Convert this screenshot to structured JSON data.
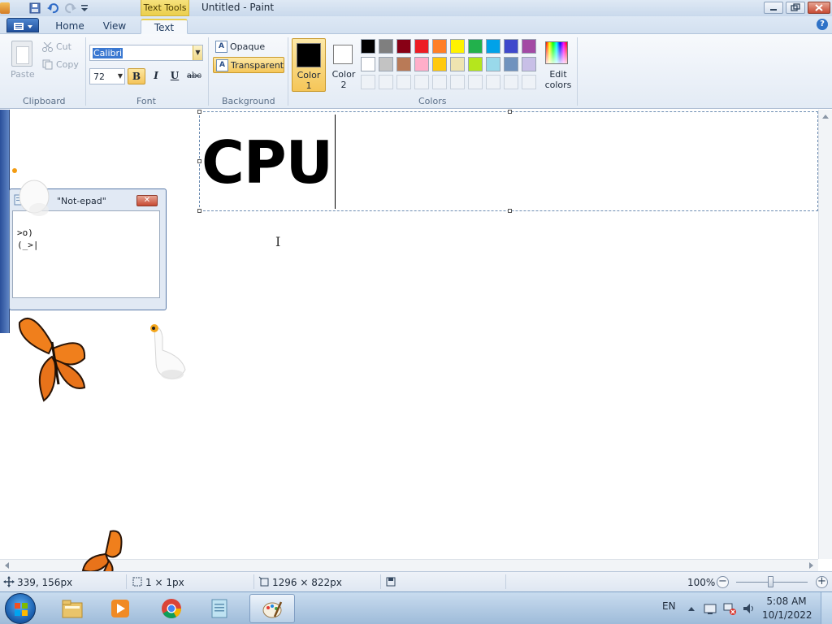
{
  "window": {
    "title": "Untitled - Paint",
    "context_tab": "Text Tools",
    "qat_icons": [
      "paint-app-icon",
      "save-icon",
      "undo-icon",
      "redo-icon",
      "customize-qat-icon"
    ]
  },
  "tabs": [
    {
      "label": "Home",
      "active": false
    },
    {
      "label": "View",
      "active": false
    },
    {
      "label": "Text",
      "active": true
    }
  ],
  "ribbon": {
    "clipboard": {
      "label": "Clipboard",
      "paste": "Paste",
      "cut": "Cut",
      "copy": "Copy"
    },
    "font": {
      "label": "Font",
      "name": "Calibri",
      "size": "72",
      "bold": "B",
      "italic": "I",
      "underline": "U",
      "strike": "abc",
      "bold_active": true
    },
    "background": {
      "label": "Background",
      "opaque": "Opaque",
      "transparent": "Transparent",
      "active": "transparent"
    },
    "colors": {
      "label": "Colors",
      "color1": {
        "label_line1": "Color",
        "label_line2": "1",
        "value": "#000000"
      },
      "color2": {
        "label_line1": "Color",
        "label_line2": "2",
        "value": "#ffffff"
      },
      "edit_line1": "Edit",
      "edit_line2": "colors",
      "row1": [
        "#000000",
        "#7f7f7f",
        "#880015",
        "#ed1c24",
        "#ff7f27",
        "#fff200",
        "#22b14c",
        "#00a2e8",
        "#3f48cc",
        "#a349a4"
      ],
      "row2": [
        "#ffffff",
        "#c3c3c3",
        "#b97a57",
        "#ffaec9",
        "#ffc90e",
        "#efe4b0",
        "#b5e61d",
        "#99d9ea",
        "#7092be",
        "#c8bfe7"
      ]
    }
  },
  "canvas": {
    "text": "CPU"
  },
  "mini_window": {
    "title": "\"Not-epad\"",
    "line1": ">o)",
    "line2": " (_>|"
  },
  "statusbar": {
    "cursor_pos": "339, 156px",
    "selection_size": "1 × 1px",
    "image_size": "1296 × 822px",
    "zoom": "100%"
  },
  "taskbar": {
    "apps": [
      "windows-explorer-icon",
      "media-player-icon",
      "chrome-icon",
      "notepad-icon",
      "paint-icon"
    ],
    "active_app": "paint-icon",
    "language": "EN",
    "time": "5:08 AM",
    "date": "10/1/2022"
  }
}
